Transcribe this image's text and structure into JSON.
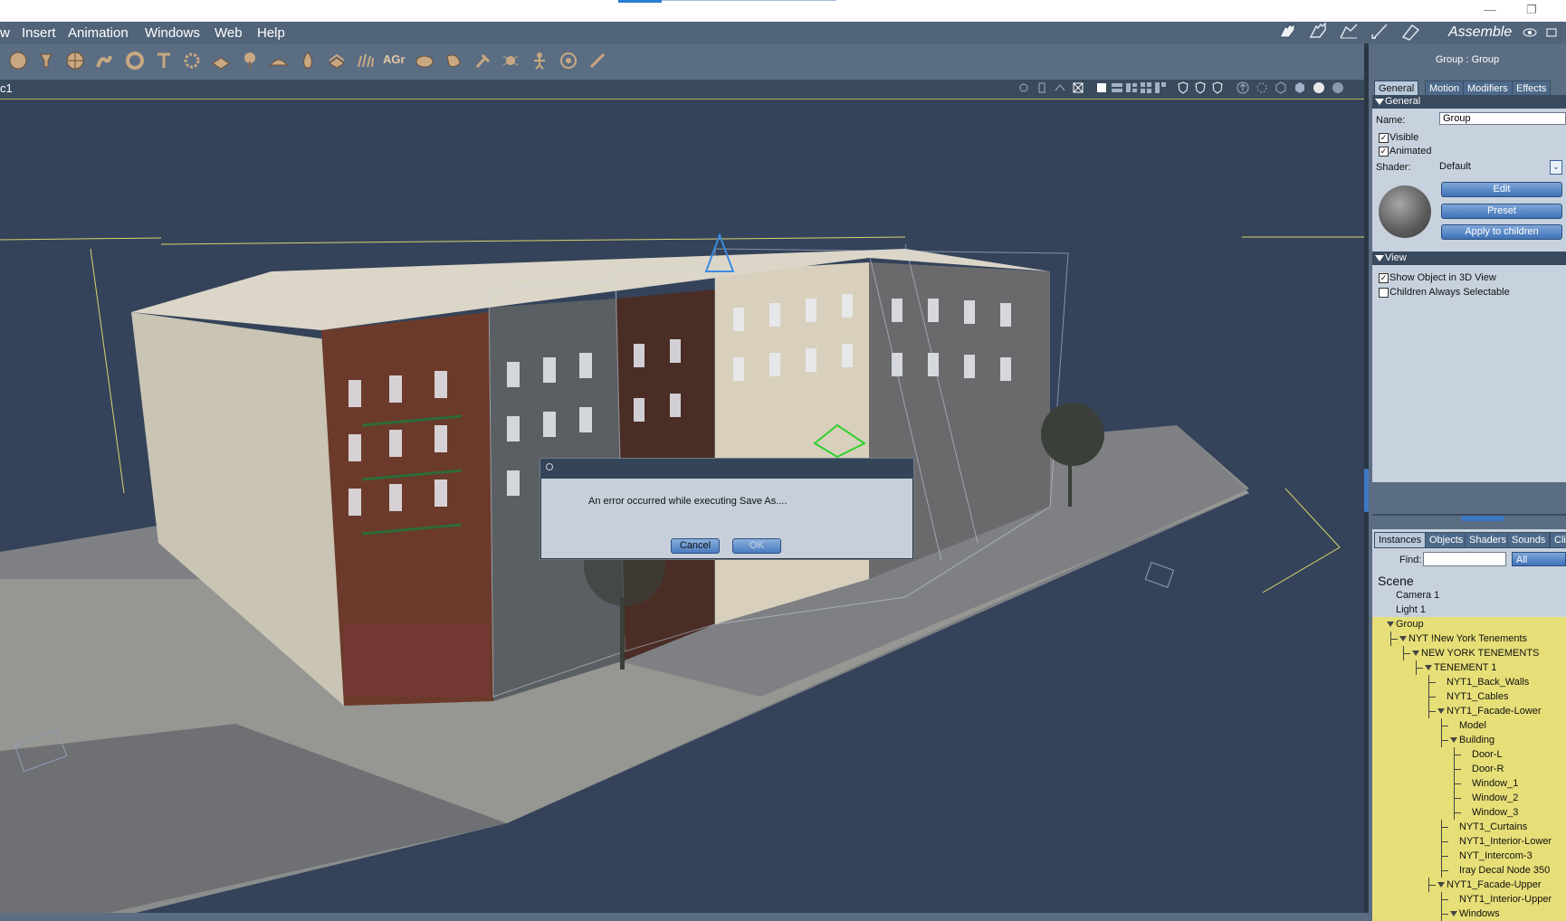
{
  "menubar": {
    "items": [
      "w",
      "Insert",
      "Animation",
      "Windows",
      "Web",
      "Help"
    ]
  },
  "workspace": {
    "label": "Assemble"
  },
  "toolbar": {
    "icons": [
      "sphere-primitive-icon",
      "cone-primitive-icon",
      "globe-primitive-icon",
      "figure-primitive-icon",
      "torus-primitive-icon",
      "text-primitive-icon",
      "particle-primitive-icon",
      "plane-primitive-icon",
      "tree-primitive-icon",
      "terrain-primitive-icon",
      "fire-primitive-icon",
      "cloud-primitive-icon",
      "grass-primitive-icon",
      "agr-primitive-icon",
      "rock-primitive-icon",
      "shell-primitive-icon",
      "hammer-tool-icon",
      "bug-primitive-icon",
      "skeleton-primitive-icon",
      "target-tool-icon",
      "bone-tool-icon"
    ],
    "agr_text": "AGr"
  },
  "viewport": {
    "name": "c1"
  },
  "properties": {
    "title": "Group : Group",
    "tabs": [
      "General",
      "Motion",
      "Modifiers",
      "Effects"
    ],
    "general_header": "General",
    "name_label": "Name:",
    "name_value": "Group",
    "visible_label": "Visible",
    "visible_checked": true,
    "animated_label": "Animated",
    "animated_checked": true,
    "shader_label": "Shader:",
    "shader_value": "Default",
    "edit_button": "Edit",
    "preset_button": "Preset",
    "apply_button": "Apply to children",
    "view_header": "View",
    "show_label": "Show Object in 3D View",
    "show_checked": true,
    "children_label": "Children Always Selectable",
    "children_checked": false
  },
  "scene": {
    "tabs": [
      "Instances",
      "Objects",
      "Shaders",
      "Sounds",
      "Cli"
    ],
    "find_label": "Find:",
    "find_value": "",
    "filter_value": "All",
    "header": "Scene",
    "rows": [
      {
        "label": "Camera 1",
        "depth": 0,
        "selected": false,
        "expandable": false
      },
      {
        "label": "Light 1",
        "depth": 0,
        "selected": false,
        "expandable": false
      },
      {
        "label": "Group",
        "depth": 0,
        "selected": true,
        "expandable": true
      },
      {
        "label": "NYT !New York Tenements",
        "depth": 1,
        "selected": true,
        "expandable": true
      },
      {
        "label": "NEW YORK TENEMENTS",
        "depth": 2,
        "selected": true,
        "expandable": true
      },
      {
        "label": "TENEMENT 1",
        "depth": 3,
        "selected": true,
        "expandable": true
      },
      {
        "label": "NYT1_Back_Walls",
        "depth": 4,
        "selected": true,
        "expandable": false
      },
      {
        "label": "NYT1_Cables",
        "depth": 4,
        "selected": true,
        "expandable": false
      },
      {
        "label": "NYT1_Facade-Lower",
        "depth": 4,
        "selected": true,
        "expandable": true
      },
      {
        "label": "Model",
        "depth": 5,
        "selected": true,
        "expandable": false
      },
      {
        "label": "Building",
        "depth": 5,
        "selected": true,
        "expandable": true
      },
      {
        "label": "Door-L",
        "depth": 6,
        "selected": true,
        "expandable": false
      },
      {
        "label": "Door-R",
        "depth": 6,
        "selected": true,
        "expandable": false
      },
      {
        "label": "Window_1",
        "depth": 6,
        "selected": true,
        "expandable": false
      },
      {
        "label": "Window_2",
        "depth": 6,
        "selected": true,
        "expandable": false
      },
      {
        "label": "Window_3",
        "depth": 6,
        "selected": true,
        "expandable": false
      },
      {
        "label": "NYT1_Curtains",
        "depth": 5,
        "selected": true,
        "expandable": false
      },
      {
        "label": "NYT1_Interior-Lower",
        "depth": 5,
        "selected": true,
        "expandable": false
      },
      {
        "label": "NYT_Intercom-3",
        "depth": 5,
        "selected": true,
        "expandable": false
      },
      {
        "label": "Iray Decal Node 350",
        "depth": 5,
        "selected": true,
        "expandable": false
      },
      {
        "label": "NYT1_Facade-Upper",
        "depth": 4,
        "selected": true,
        "expandable": true
      },
      {
        "label": "NYT1_Interior-Upper",
        "depth": 5,
        "selected": true,
        "expandable": false
      },
      {
        "label": "Windows",
        "depth": 5,
        "selected": true,
        "expandable": true
      }
    ]
  },
  "dialog": {
    "message": "An error occurred while executing Save As....",
    "cancel_label": "Cancel",
    "ok_label": "OK"
  },
  "colors": {
    "selection": "#e6df77",
    "accent": "#3f72b7",
    "panel": "#c8d2df"
  }
}
